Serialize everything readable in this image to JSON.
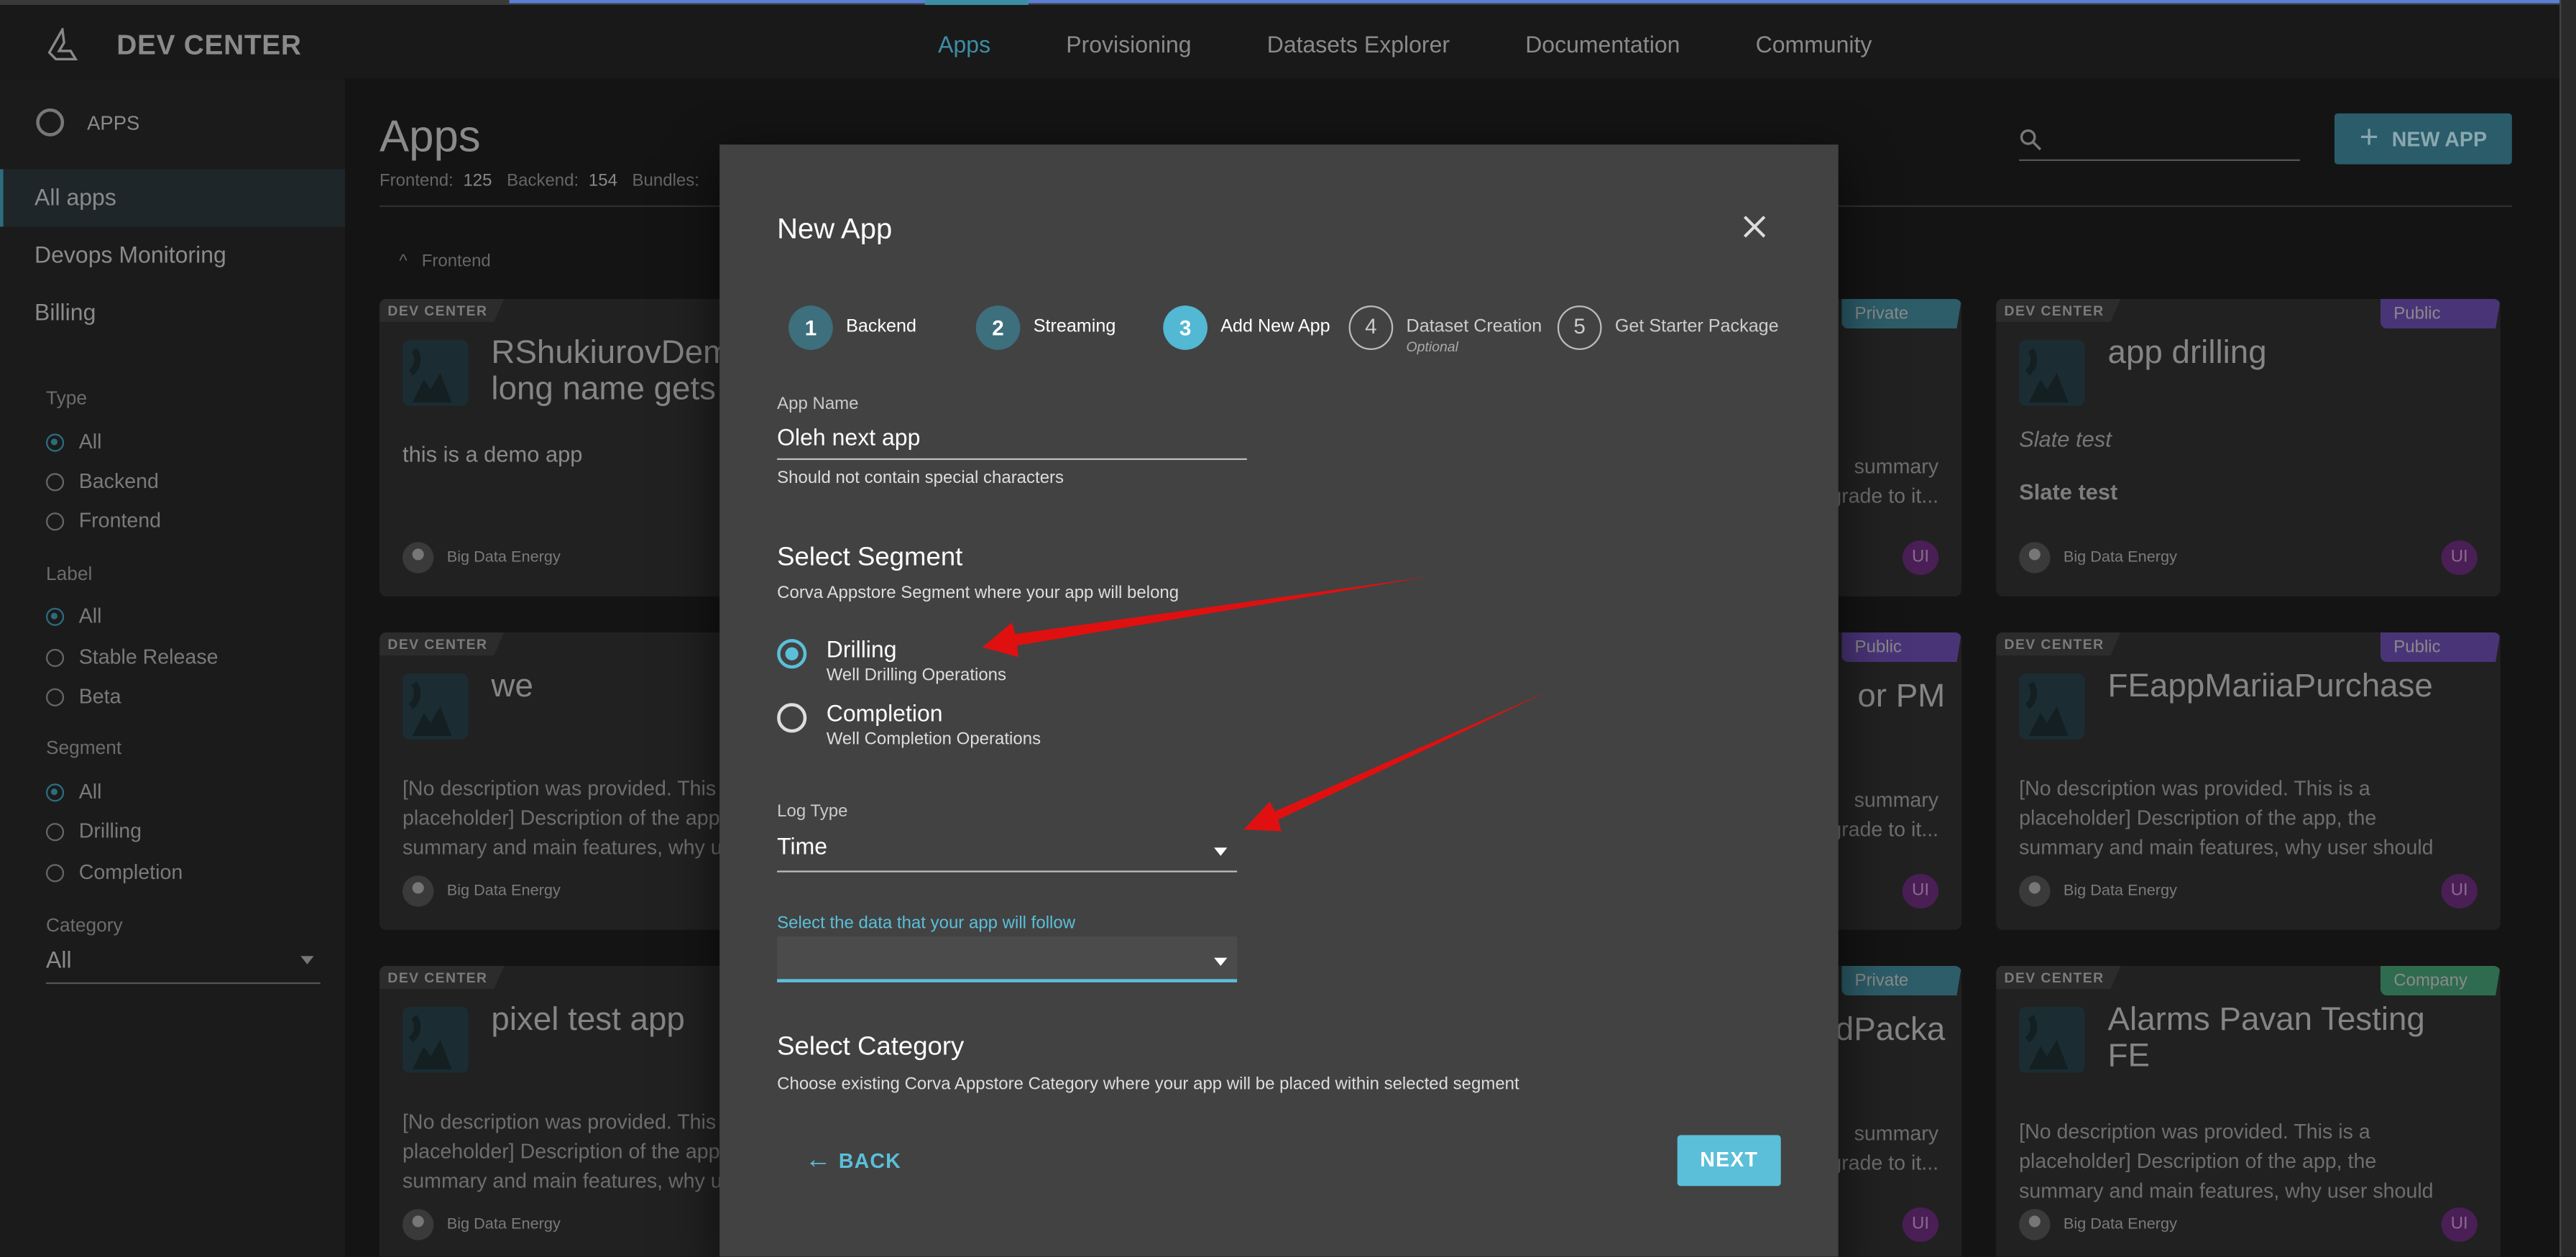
{
  "topbar": {
    "brand": "DEV CENTER",
    "nav": [
      "Apps",
      "Provisioning",
      "Datasets Explorer",
      "Documentation",
      "Community"
    ],
    "active_nav": "Apps"
  },
  "sidebar": {
    "section": "APPS",
    "items": [
      "All apps",
      "Devops Monitoring",
      "Billing"
    ],
    "filters": {
      "type_label": "Type",
      "type_options": [
        "All",
        "Backend",
        "Frontend"
      ],
      "label_label": "Label",
      "label_options": [
        "All",
        "Stable Release",
        "Beta"
      ],
      "segment_label": "Segment",
      "segment_options": [
        "All",
        "Drilling",
        "Completion"
      ],
      "category_label": "Category",
      "category_value": "All"
    }
  },
  "page": {
    "title": "Apps",
    "stats": {
      "frontend_label": "Frontend:",
      "frontend": "125",
      "backend_label": "Backend:",
      "backend": "154",
      "bundles_label": "Bundles:"
    },
    "new_app": "NEW APP",
    "section": "Frontend",
    "accent": "#52b8d3"
  },
  "cards": [
    {
      "tag": "DEV CENTER",
      "title": "RShukiurovDem\nlong name gets",
      "desc": "this is a demo app",
      "owner": "Big Data Energy"
    },
    {
      "tag": "DEV CENTER",
      "title": "app drilling",
      "visibility": "Public",
      "italic": "Slate test",
      "bold": "Slate test",
      "owner": "Big Data Energy",
      "badge": "UI"
    },
    {
      "tag": "DEV CENTER",
      "title": "we",
      "desc": "[No description was provided. This is a placeholder] Description of the app, the summary and main features, why user should",
      "owner": "Big Data Energy"
    },
    {
      "tag": "DEV CENTER",
      "title": "FEappMariiaPurchase",
      "visibility": "Public",
      "desc": "[No description was provided. This is a placeholder] Description of the app, the summary and main features, why user should upgrade to it...",
      "owner": "Big Data Energy",
      "badge": "UI"
    },
    {
      "tag": "DEV CENTER",
      "title": "pixel test app",
      "desc": "[No description was provided. This is a placeholder] Description of the app, the summary and main features, why user should",
      "owner": "Big Data Energy"
    },
    {
      "tag": "DEV CENTER",
      "title": "Alarms Pavan Testing\nFE",
      "visibility": "Company",
      "desc": "[No description was provided. This is a placeholder] Description of the app, the summary and main features, why user should upgrade to it...",
      "owner": "Big Data Energy",
      "badge": "UI"
    }
  ],
  "partial_cards": [
    {
      "visibility": "Private",
      "title": "",
      "frag1": "summary",
      "frag2": "grade to it...",
      "badge": "UI"
    },
    {
      "visibility": "Public",
      "title": "or PM",
      "frag1": "summary",
      "frag2": "grade to it...",
      "badge": "UI"
    },
    {
      "visibility": "Private",
      "title": "dPacka",
      "frag1": "summary",
      "frag2": "grade to it...",
      "badge": "UI"
    }
  ],
  "modal": {
    "title": "New App",
    "steps": [
      {
        "n": "1",
        "label": "Backend"
      },
      {
        "n": "2",
        "label": "Streaming"
      },
      {
        "n": "3",
        "label": "Add New App"
      },
      {
        "n": "4",
        "label": "Dataset Creation",
        "sub": "Optional"
      },
      {
        "n": "5",
        "label": "Get Starter Package"
      }
    ],
    "app_name_label": "App Name",
    "app_name_value": "Oleh next app",
    "app_name_help": "Should not contain special characters",
    "segment_title": "Select Segment",
    "segment_help": "Corva Appstore Segment where your app will belong",
    "segments": [
      {
        "label": "Drilling",
        "sub": "Well Drilling Operations",
        "selected": true
      },
      {
        "label": "Completion",
        "sub": "Well Completion Operations",
        "selected": false
      }
    ],
    "log_type_label": "Log Type",
    "log_type_value": "Time",
    "data_follow_label": "Select the data that your app will follow",
    "data_follow_value": "",
    "category_title": "Select Category",
    "category_help": "Choose existing Corva Appstore Category where your app will be placed within selected segment",
    "back": "BACK",
    "next": "NEXT"
  },
  "colors": {
    "private": "#2c5d69",
    "public": "#4a3478",
    "company": "#2f6b4e",
    "accent": "#52b8d3",
    "arrow": "#e01010"
  }
}
